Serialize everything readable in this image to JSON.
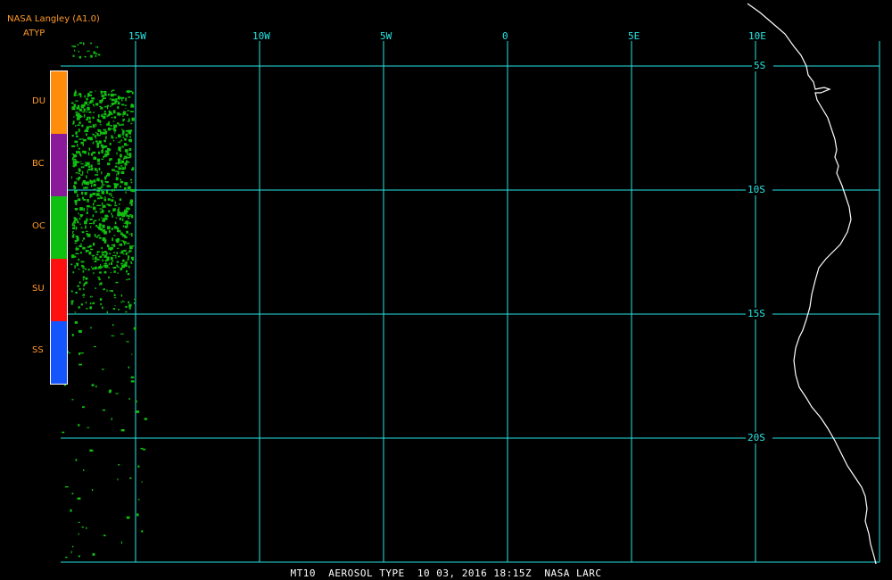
{
  "header": {
    "source": "NASA Langley (A1.0)",
    "product": "ATYP"
  },
  "legend": {
    "items": [
      {
        "label": "DU",
        "color": "#ff8c0a"
      },
      {
        "label": "BC",
        "color": "#8a1a9a"
      },
      {
        "label": "OC",
        "color": "#10c010"
      },
      {
        "label": "SU",
        "color": "#ff1010"
      },
      {
        "label": "SS",
        "color": "#1555ff"
      }
    ]
  },
  "map": {
    "grid_color": "#26e6e6",
    "coast_color": "#ffffff",
    "longitude_labels": [
      "15W",
      "10W",
      "5W",
      "0",
      "5E",
      "10E"
    ],
    "latitude_labels": [
      "5S",
      "10S",
      "15S",
      "20S"
    ]
  },
  "caption": "MT10  AEROSOL TYPE  10 03, 2016 18:15Z  NASA LARC"
}
